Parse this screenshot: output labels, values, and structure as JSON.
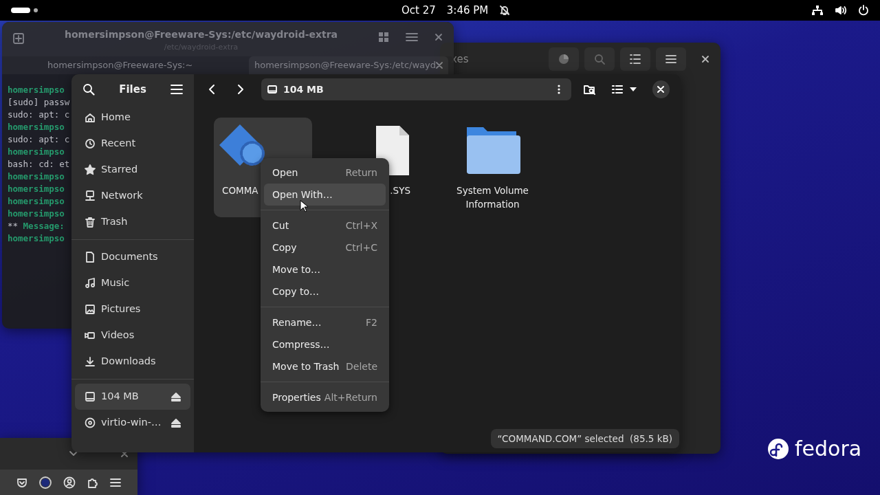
{
  "top_bar": {
    "date": "Oct 27",
    "time": "3:46 PM"
  },
  "terminal": {
    "title": "homersimpson@Freeware-Sys:/etc/waydroid-extra",
    "subtitle": "/etc/waydroid-extra",
    "tabs": [
      {
        "label": "homersimpson@Freeware-Sys:~",
        "selected": false
      },
      {
        "label": "homersimpson@Freeware-Sys:/etc/wayd",
        "selected": true
      }
    ],
    "lines": [
      {
        "kind": "prompt",
        "text": "homersimpso"
      },
      {
        "kind": "output",
        "text": "[sudo] passw"
      },
      {
        "kind": "output",
        "text": "sudo: apt: c"
      },
      {
        "kind": "prompt",
        "text": "homersimpso"
      },
      {
        "kind": "output",
        "text": "sudo: apt: c"
      },
      {
        "kind": "prompt",
        "text": "homersimpso"
      },
      {
        "kind": "output",
        "text": "bash: cd: et"
      },
      {
        "kind": "prompt",
        "text": "homersimpso"
      },
      {
        "kind": "prompt",
        "text": "homersimpso"
      },
      {
        "kind": "prompt",
        "text": "homersimpso"
      },
      {
        "kind": "prompt",
        "text": "homersimpso"
      },
      {
        "kind": "message",
        "marker": "**",
        "text": "Message:"
      },
      {
        "kind": "prompt",
        "text": "homersimpso"
      }
    ]
  },
  "background_window": {
    "title_fragment": "xes"
  },
  "files": {
    "title": "Files",
    "location": "104 MB",
    "sidebar": [
      [
        {
          "label": "Home",
          "selected": false,
          "ejectable": false
        },
        {
          "label": "Recent",
          "selected": false,
          "ejectable": false
        },
        {
          "label": "Starred",
          "selected": false,
          "ejectable": false
        },
        {
          "label": "Network",
          "selected": false,
          "ejectable": false
        },
        {
          "label": "Trash",
          "selected": false,
          "ejectable": false
        }
      ],
      [
        {
          "label": "Documents",
          "selected": false,
          "ejectable": false
        },
        {
          "label": "Music",
          "selected": false,
          "ejectable": false
        },
        {
          "label": "Pictures",
          "selected": false,
          "ejectable": false
        },
        {
          "label": "Videos",
          "selected": false,
          "ejectable": false
        },
        {
          "label": "Downloads",
          "selected": false,
          "ejectable": false
        }
      ],
      [
        {
          "label": "104 MB",
          "selected": true,
          "ejectable": true
        },
        {
          "label": "virtio-win-…",
          "selected": false,
          "ejectable": true
        }
      ]
    ],
    "items": [
      {
        "label": "COMMA",
        "selected": true
      },
      {
        "label": ".SYS",
        "selected": false
      },
      {
        "label": "System Volume Information",
        "selected": false
      }
    ],
    "context_menu": [
      [
        {
          "label": "Open",
          "shortcut": "Return",
          "highlighted": false
        },
        {
          "label": "Open With…",
          "highlighted": true
        }
      ],
      [
        {
          "label": "Cut",
          "shortcut": "Ctrl+X",
          "highlighted": false
        },
        {
          "label": "Copy",
          "shortcut": "Ctrl+C",
          "highlighted": false
        },
        {
          "label": "Move to…",
          "highlighted": false
        },
        {
          "label": "Copy to…",
          "highlighted": false
        }
      ],
      [
        {
          "label": "Rename…",
          "shortcut": "F2",
          "highlighted": false
        },
        {
          "label": "Compress…",
          "highlighted": false
        },
        {
          "label": "Move to Trash",
          "shortcut": "Delete",
          "highlighted": false
        }
      ],
      [
        {
          "label": "Properties",
          "shortcut": "Alt+Return",
          "highlighted": false
        }
      ]
    ],
    "status": "“COMMAND.COM” selected  (85.5 kB)"
  },
  "brand": {
    "wordmark": "fedora"
  }
}
